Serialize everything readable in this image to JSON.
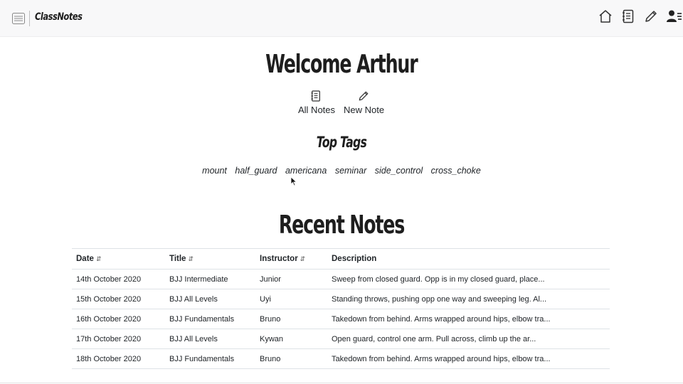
{
  "app": {
    "brand": "ClassNotes",
    "nav_icons": [
      "home-icon",
      "notebook-icon",
      "pencil-icon",
      "user-list-icon"
    ]
  },
  "welcome": {
    "title": "Welcome Arthur"
  },
  "quick_actions": [
    {
      "label": "All Notes",
      "icon": "notebook-icon"
    },
    {
      "label": "New Note",
      "icon": "pencil-icon"
    }
  ],
  "top_tags": {
    "heading": "Top Tags",
    "tags": [
      "mount",
      "half_guard",
      "americana",
      "seminar",
      "side_control",
      "cross_choke"
    ]
  },
  "recent_notes": {
    "heading": "Recent Notes",
    "columns": [
      {
        "label": "Date",
        "sortable": true,
        "sort_glyph": "⇵"
      },
      {
        "label": "Title",
        "sortable": true,
        "sort_glyph": "⇵"
      },
      {
        "label": "Instructor",
        "sortable": true,
        "sort_glyph": "⇵"
      },
      {
        "label": "Description",
        "sortable": false,
        "sort_glyph": ""
      }
    ],
    "rows": [
      [
        "14th October 2020",
        "BJJ Intermediate",
        "Junior",
        "Sweep from closed guard. Opp is in my closed guard, place..."
      ],
      [
        "15th October 2020",
        "BJJ All Levels",
        "Uyi",
        "Standing throws, pushing opp one way and sweeping leg. Al..."
      ],
      [
        "16th October 2020",
        "BJJ Fundamentals",
        "Bruno",
        "Takedown from behind. Arms wrapped around hips, elbow tra..."
      ],
      [
        "17th October 2020",
        "BJJ All Levels",
        "Kywan",
        "Open guard, control one arm. Pull across, climb up the ar..."
      ],
      [
        "18th October 2020",
        "BJJ Fundamentals",
        "Bruno",
        "Takedown from behind. Arms wrapped around hips, elbow tra..."
      ]
    ]
  }
}
